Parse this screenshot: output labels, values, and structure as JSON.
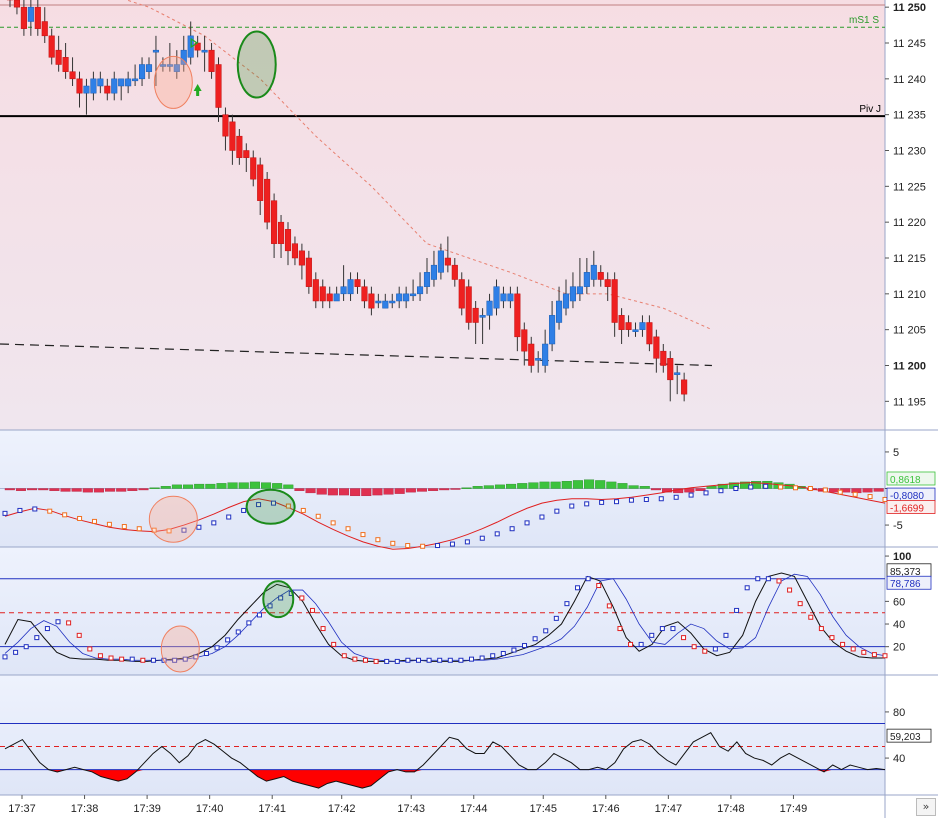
{
  "colors": {
    "price_bg": "#f7e4e8",
    "osc_bg": "#e6ecfa",
    "bull": "#2f7fe6",
    "bear": "#ee2020",
    "dot_blue": "#2030c0",
    "dot_red": "#e02020",
    "dot_orange": "#f07020",
    "ma_dashed": "#e88070",
    "hist_pos": "#3cc23c",
    "hist_neg": "#e03050",
    "fill_neg": "#ff0000"
  },
  "price_panel": {
    "ylim": [
      11191,
      11251
    ],
    "y_ticks": [
      {
        "v": 11250,
        "label": "11 250",
        "bold": true
      },
      {
        "v": 11245,
        "label": "11 245"
      },
      {
        "v": 11240,
        "label": "11 240"
      },
      {
        "v": 11235,
        "label": "11 235"
      },
      {
        "v": 11230,
        "label": "11 230"
      },
      {
        "v": 11225,
        "label": "11 225"
      },
      {
        "v": 11220,
        "label": "11 220"
      },
      {
        "v": 11215,
        "label": "11 215"
      },
      {
        "v": 11210,
        "label": "11 210"
      },
      {
        "v": 11205,
        "label": "11 205"
      },
      {
        "v": 11200,
        "label": "11 200",
        "bold": true
      },
      {
        "v": 11195,
        "label": "11 195"
      }
    ],
    "levels": [
      {
        "name": "mS1 S",
        "value": 11247.2,
        "style": "green-dashed"
      },
      {
        "name": "Piv J",
        "value": 11234.8,
        "style": "black-solid"
      }
    ],
    "top_line": 11250.3,
    "candles": [
      [
        11252,
        11252,
        11250,
        11251
      ],
      [
        11251,
        11252,
        11249,
        11250
      ],
      [
        11250,
        11251,
        11246,
        11247
      ],
      [
        11248,
        11251,
        11246,
        11250
      ],
      [
        11250,
        11251,
        11246,
        11247
      ],
      [
        11248,
        11250,
        11245,
        11246
      ],
      [
        11246,
        11247,
        11242,
        11243
      ],
      [
        11244,
        11246,
        11241,
        11242
      ],
      [
        11243,
        11245,
        11240,
        11241
      ],
      [
        11241,
        11243,
        11239,
        11240
      ],
      [
        11240,
        11241,
        11236,
        11238
      ],
      [
        11238,
        11240,
        11235,
        11239
      ],
      [
        11238,
        11241,
        11237,
        11240
      ],
      [
        11239,
        11241,
        11238,
        11240
      ],
      [
        11239,
        11240,
        11237,
        11238
      ],
      [
        11238,
        11241,
        11237,
        11240
      ],
      [
        11239,
        11240,
        11237,
        11240
      ],
      [
        11239,
        11241,
        11238,
        11240
      ],
      [
        11240,
        11242,
        11239,
        11240
      ],
      [
        11240,
        11243,
        11239,
        11242
      ],
      [
        11241,
        11243,
        11240,
        11242
      ],
      [
        11244,
        11246,
        11239,
        11244
      ],
      [
        11242,
        11243,
        11241,
        11242
      ],
      [
        11242,
        11245,
        11241,
        11242
      ],
      [
        11241,
        11244,
        11240,
        11242
      ],
      [
        11242,
        11246,
        11241,
        11244
      ],
      [
        11243,
        11248,
        11242,
        11246
      ],
      [
        11245,
        11246,
        11243,
        11244
      ],
      [
        11244,
        11246,
        11241,
        11244
      ],
      [
        11244,
        11245,
        11240,
        11241
      ],
      [
        11242,
        11243,
        11234,
        11236
      ],
      [
        11235,
        11236,
        11230,
        11232
      ],
      [
        11234,
        11235,
        11228,
        11230
      ],
      [
        11232,
        11233,
        11228,
        11229
      ],
      [
        11230,
        11231,
        11227,
        11229
      ],
      [
        11229,
        11230,
        11225,
        11226
      ],
      [
        11228,
        11229,
        11221,
        11223
      ],
      [
        11226,
        11227,
        11219,
        11220
      ],
      [
        11223,
        11224,
        11215,
        11217
      ],
      [
        11220,
        11221,
        11215,
        11217
      ],
      [
        11219,
        11220,
        11214,
        11216
      ],
      [
        11217,
        11218,
        11214,
        11215
      ],
      [
        11216,
        11217,
        11212,
        11214
      ],
      [
        11215,
        11216,
        11210,
        11211
      ],
      [
        11212,
        11213,
        11208,
        11209
      ],
      [
        11211,
        11212,
        11208,
        11209
      ],
      [
        11210,
        11211,
        11208,
        11209
      ],
      [
        11209,
        11211,
        11209,
        11210
      ],
      [
        11210,
        11214,
        11209,
        11211
      ],
      [
        11210,
        11213,
        11209,
        11212
      ],
      [
        11212,
        11213,
        11210,
        11211
      ],
      [
        11211,
        11212,
        11208,
        11209
      ],
      [
        11210,
        11211,
        11207,
        11208
      ],
      [
        11209,
        11210,
        11208,
        11209
      ],
      [
        11208,
        11210,
        11208,
        11209
      ],
      [
        11209,
        11210,
        11208,
        11209
      ],
      [
        11209,
        11211,
        11208,
        11210
      ],
      [
        11209,
        11211,
        11208,
        11210
      ],
      [
        11210,
        11212,
        11209,
        11210
      ],
      [
        11210,
        11213,
        11209,
        11211
      ],
      [
        11211,
        11215,
        11210,
        11213
      ],
      [
        11212,
        11216,
        11211,
        11214
      ],
      [
        11213,
        11217,
        11212,
        11216
      ],
      [
        11215,
        11218,
        11213,
        11214
      ],
      [
        11214,
        11215,
        11211,
        11212
      ],
      [
        11212,
        11213,
        11207,
        11208
      ],
      [
        11211,
        11212,
        11205,
        11206
      ],
      [
        11208,
        11209,
        11203,
        11206
      ],
      [
        11207,
        11208,
        11203,
        11207
      ],
      [
        11207,
        11210,
        11205,
        11209
      ],
      [
        11208,
        11212,
        11207,
        11211
      ],
      [
        11209,
        11211,
        11208,
        11210
      ],
      [
        11209,
        11211,
        11208,
        11210
      ],
      [
        11210,
        11211,
        11202,
        11204
      ],
      [
        11205,
        11206,
        11200,
        11202
      ],
      [
        11203,
        11204,
        11199,
        11200
      ],
      [
        11201,
        11202,
        11199,
        11201
      ],
      [
        11200,
        11205,
        11199,
        11203
      ],
      [
        11203,
        11209,
        11202,
        11207
      ],
      [
        11206,
        11211,
        11205,
        11209
      ],
      [
        11208,
        11212,
        11207,
        11210
      ],
      [
        11209,
        11213,
        11208,
        11211
      ],
      [
        11210,
        11215,
        11209,
        11211
      ],
      [
        11211,
        11215,
        11210,
        11213
      ],
      [
        11212,
        11216,
        11211,
        11214
      ],
      [
        11213,
        11214,
        11211,
        11212
      ],
      [
        11212,
        11213,
        11209,
        11211
      ],
      [
        11212,
        11213,
        11204,
        11206
      ],
      [
        11207,
        11208,
        11203,
        11205
      ],
      [
        11206,
        11207,
        11204,
        11205
      ],
      [
        11205,
        11206,
        11204,
        11205
      ],
      [
        11205,
        11207,
        11204,
        11206
      ],
      [
        11206,
        11207,
        11202,
        11203
      ],
      [
        11204,
        11205,
        11199,
        11201
      ],
      [
        11202,
        11203,
        11199,
        11200
      ],
      [
        11201,
        11202,
        11195,
        11198
      ],
      [
        11199,
        11200,
        11196,
        11199
      ],
      [
        11198,
        11199,
        11195,
        11196
      ]
    ],
    "ma_dashed": [
      [
        0,
        11252
      ],
      [
        12,
        11252.5
      ],
      [
        20,
        11250
      ],
      [
        28,
        11246
      ],
      [
        36,
        11240
      ],
      [
        44,
        11232
      ],
      [
        52,
        11225
      ],
      [
        60,
        11217
      ],
      [
        66,
        11215
      ],
      [
        72,
        11213
      ],
      [
        80,
        11210
      ],
      [
        86,
        11210
      ],
      [
        94,
        11208
      ],
      [
        101,
        11205
      ]
    ],
    "trend_line": [
      [
        -0.5,
        11203
      ],
      [
        101,
        11200
      ]
    ]
  },
  "macd_panel": {
    "ylim": [
      -8,
      8
    ],
    "y_ticks": [
      {
        "v": 5,
        "label": "5"
      },
      {
        "v": 0,
        "label": ""
      },
      {
        "v": -5,
        "label": "-5"
      }
    ],
    "badges": [
      {
        "value": "0,8618",
        "v": 1.3,
        "color": "#3cc23c",
        "bg": "#eef8ee"
      },
      {
        "value": "-0,8080",
        "v": -0.9,
        "color": "#2030c0",
        "bg": "#eef0fb"
      },
      {
        "value": "-1,6699",
        "v": -2.6,
        "color": "#e02020",
        "bg": "#fbeeee"
      }
    ],
    "histogram": [
      -0.2,
      -0.3,
      -0.2,
      -0.2,
      -0.3,
      -0.4,
      -0.4,
      -0.5,
      -0.5,
      -0.4,
      -0.4,
      -0.3,
      -0.2,
      0.1,
      0.3,
      0.5,
      0.5,
      0.6,
      0.6,
      0.7,
      0.8,
      0.8,
      0.9,
      0.8,
      0.7,
      0.5,
      -0.3,
      -0.6,
      -0.8,
      -0.9,
      -0.9,
      -1.0,
      -1.0,
      -0.9,
      -0.8,
      -0.7,
      -0.5,
      -0.4,
      -0.3,
      -0.2,
      -0.1,
      0.1,
      0.3,
      0.4,
      0.5,
      0.6,
      0.7,
      0.8,
      0.9,
      0.9,
      1.0,
      1.1,
      1.2,
      1.1,
      0.9,
      0.7,
      0.4,
      0.3,
      -0.2,
      -0.5,
      -0.6,
      -0.5,
      -0.3,
      0.3,
      0.6,
      0.8,
      0.9,
      1.0,
      1.0,
      0.8,
      0.6,
      0.3,
      -0.2,
      -0.4,
      -0.5,
      -0.5,
      -0.6,
      -0.5,
      -0.4
    ],
    "signal_pts": [
      -3.4,
      -3.0,
      -2.8,
      -3.1,
      -3.6,
      -4.1,
      -4.5,
      -4.9,
      -5.2,
      -5.5,
      -5.7,
      -5.8,
      -5.7,
      -5.3,
      -4.7,
      -3.9,
      -3.0,
      -2.2,
      -2.0,
      -2.4,
      -3.0,
      -3.8,
      -4.7,
      -5.5,
      -6.3,
      -7.0,
      -7.5,
      -7.8,
      -7.9,
      -7.8,
      -7.6,
      -7.3,
      -6.8,
      -6.2,
      -5.5,
      -4.7,
      -3.9,
      -3.1,
      -2.4,
      -2.1,
      -1.9,
      -1.8,
      -1.6,
      -1.5,
      -1.4,
      -1.2,
      -0.9,
      -0.6,
      -0.3,
      0.0,
      0.2,
      0.3,
      0.2,
      0.1,
      0.0,
      -0.2,
      -0.5,
      -0.8,
      -1.1,
      -1.5
    ],
    "fast_pts": [
      -3.8,
      -3.2,
      -2.7,
      -3.0,
      -3.7,
      -4.3,
      -4.8,
      -5.3,
      -5.6,
      -5.8,
      -5.9,
      -5.6,
      -5.0,
      -4.3,
      -3.5,
      -2.6,
      -1.8,
      -1.4,
      -1.8,
      -2.6,
      -3.5,
      -4.6,
      -5.6,
      -6.5,
      -7.3,
      -7.9,
      -8.3,
      -8.2,
      -7.9,
      -7.5,
      -7.0,
      -6.3,
      -5.5,
      -4.6,
      -3.6,
      -2.7,
      -2.0,
      -1.6,
      -1.4,
      -1.4,
      -1.5,
      -1.4,
      -1.2,
      -0.9,
      -0.6,
      -0.2,
      0.1,
      0.3,
      0.5,
      0.7,
      0.8,
      0.7,
      0.5,
      0.3,
      0.0,
      -0.4,
      -0.8,
      -1.2,
      -1.6,
      -2.0
    ]
  },
  "stoch_panel": {
    "ylim": [
      -5,
      108
    ],
    "y_ticks": [
      {
        "v": 100,
        "label": "100",
        "bold": true
      },
      {
        "v": 60,
        "label": "60"
      },
      {
        "v": 40,
        "label": "40"
      },
      {
        "v": 20,
        "label": "20"
      }
    ],
    "levels": [
      {
        "v": 80,
        "style": "blue"
      },
      {
        "v": 50,
        "style": "red-dashed"
      },
      {
        "v": 20,
        "style": "blue"
      }
    ],
    "badges": [
      {
        "value": "85,373",
        "v": 87,
        "color": "#222222",
        "bg": "#ffffff"
      },
      {
        "value": "78,786",
        "v": 76,
        "color": "#2030c0",
        "bg": "#eef0fb"
      }
    ],
    "k_line": [
      22,
      44,
      42,
      28,
      15,
      10,
      9,
      9,
      8,
      8,
      7,
      7,
      8,
      9,
      10,
      14,
      20,
      30,
      44,
      56,
      68,
      75,
      72,
      60,
      40,
      22,
      12,
      8,
      7,
      7,
      7,
      8,
      8,
      7,
      7,
      7,
      8,
      9,
      10,
      14,
      18,
      22,
      30,
      40,
      60,
      82,
      78,
      55,
      28,
      16,
      22,
      38,
      42,
      32,
      18,
      12,
      15,
      30,
      60,
      82,
      85,
      82,
      60,
      38,
      24,
      16,
      11,
      10,
      10
    ],
    "d_line": [
      14,
      24,
      36,
      43,
      38,
      24,
      14,
      10,
      9,
      9,
      8,
      8,
      8,
      8,
      9,
      11,
      14,
      20,
      30,
      42,
      54,
      63,
      70,
      70,
      58,
      42,
      24,
      14,
      10,
      8,
      7,
      7,
      8,
      8,
      8,
      8,
      8,
      8,
      9,
      11,
      13,
      17,
      21,
      27,
      38,
      55,
      78,
      80,
      62,
      40,
      24,
      22,
      32,
      40,
      36,
      25,
      18,
      19,
      28,
      55,
      78,
      84,
      82,
      66,
      46,
      30,
      20,
      14,
      12
    ],
    "k_pts": [
      14,
      20,
      30,
      36,
      40,
      38,
      26,
      14,
      10,
      9,
      9,
      8,
      8,
      8,
      8,
      9,
      11,
      14,
      20,
      27,
      34,
      41,
      50,
      57,
      63,
      70,
      72,
      66,
      52,
      34,
      18,
      10,
      8,
      7,
      7,
      7,
      8,
      8,
      8,
      8,
      8,
      8,
      8,
      9,
      10,
      12,
      14,
      16,
      18,
      22,
      28,
      36,
      48,
      62,
      78,
      80,
      66,
      44,
      26,
      20,
      26,
      34,
      38,
      32,
      22,
      16,
      16,
      22,
      38,
      60,
      76,
      80,
      80,
      76,
      64,
      50,
      40,
      32,
      24,
      20,
      16,
      13,
      12,
      11
    ],
    "d_pts": [
      11,
      15,
      20,
      28,
      36,
      42,
      41,
      30,
      18,
      12,
      10,
      9,
      9,
      8,
      8,
      8,
      8,
      9,
      11,
      14,
      19,
      26,
      33,
      41,
      48,
      56,
      63,
      67,
      63,
      52,
      36,
      22,
      12,
      9,
      8,
      7,
      7,
      7,
      8,
      8,
      8,
      8,
      8,
      8,
      9,
      10,
      12,
      14,
      17,
      21,
      27,
      34,
      45,
      58,
      72,
      80,
      74,
      56,
      36,
      22,
      22,
      30,
      36,
      36,
      28,
      20,
      16,
      18,
      30,
      52,
      72,
      80,
      80,
      78,
      70,
      58,
      46,
      36,
      28,
      22,
      18,
      15,
      13,
      12
    ]
  },
  "rsi_panel": {
    "ylim": [
      8,
      112
    ],
    "y_ticks": [
      {
        "v": 80,
        "label": "80"
      },
      {
        "v": 40,
        "label": "40"
      }
    ],
    "levels": [
      {
        "v": 70,
        "style": "blue"
      },
      {
        "v": 50,
        "style": "red-dashed"
      },
      {
        "v": 30,
        "style": "blue"
      }
    ],
    "badges": [
      {
        "value": "59,203",
        "v": 59,
        "color": "#222222",
        "bg": "#ffffff"
      }
    ],
    "line": [
      48,
      52,
      56,
      46,
      36,
      30,
      28,
      30,
      32,
      30,
      28,
      24,
      22,
      20,
      22,
      28,
      36,
      44,
      50,
      44,
      36,
      42,
      52,
      56,
      52,
      46,
      40,
      36,
      30,
      24,
      20,
      22,
      24,
      20,
      18,
      16,
      14,
      18,
      20,
      18,
      16,
      14,
      16,
      22,
      28,
      30,
      28,
      28,
      34,
      42,
      50,
      58,
      56,
      48,
      44,
      44,
      54,
      50,
      42,
      34,
      30,
      30,
      36,
      44,
      40,
      36,
      30,
      30,
      32,
      30,
      36,
      48,
      54,
      56,
      52,
      44,
      38,
      34,
      44,
      54,
      58,
      62,
      50,
      46,
      54,
      44,
      40,
      38,
      34,
      40,
      44,
      40,
      36,
      32,
      28,
      34,
      30,
      34,
      32,
      30,
      31,
      30
    ]
  },
  "time_axis": {
    "labels": [
      {
        "i": 0,
        "label": "17:37"
      },
      {
        "i": 9,
        "label": "17:38"
      },
      {
        "i": 18,
        "label": "17:39"
      },
      {
        "i": 27,
        "label": "17:40"
      },
      {
        "i": 36,
        "label": "17:41"
      },
      {
        "i": 46,
        "label": "17:42"
      },
      {
        "i": 56,
        "label": "17:43"
      },
      {
        "i": 65,
        "label": "17:44"
      },
      {
        "i": 75,
        "label": "17:45"
      },
      {
        "i": 84,
        "label": "17:46"
      },
      {
        "i": 93,
        "label": "17:47"
      },
      {
        "i": 102,
        "label": "17:48"
      },
      {
        "i": 111,
        "label": "17:49"
      }
    ],
    "scroll_button": "»"
  },
  "chart_data": {
    "type": "candlestick",
    "title": "",
    "xlabel": "",
    "ylabel": "",
    "ylim": [
      11191,
      11251
    ],
    "x_ticks": [
      "17:37",
      "17:38",
      "17:39",
      "17:40",
      "17:41",
      "17:42",
      "17:43",
      "17:44",
      "17:45",
      "17:46",
      "17:47",
      "17:48",
      "17:49"
    ],
    "series": [
      {
        "name": "mS1 S",
        "value": 11247.2
      },
      {
        "name": "Piv J",
        "value": 11234.8
      }
    ],
    "indicator_values": [
      "0,8618",
      "-0,8080",
      "-1,6699",
      "85,373",
      "78,786",
      "59,203"
    ],
    "grid": false
  }
}
